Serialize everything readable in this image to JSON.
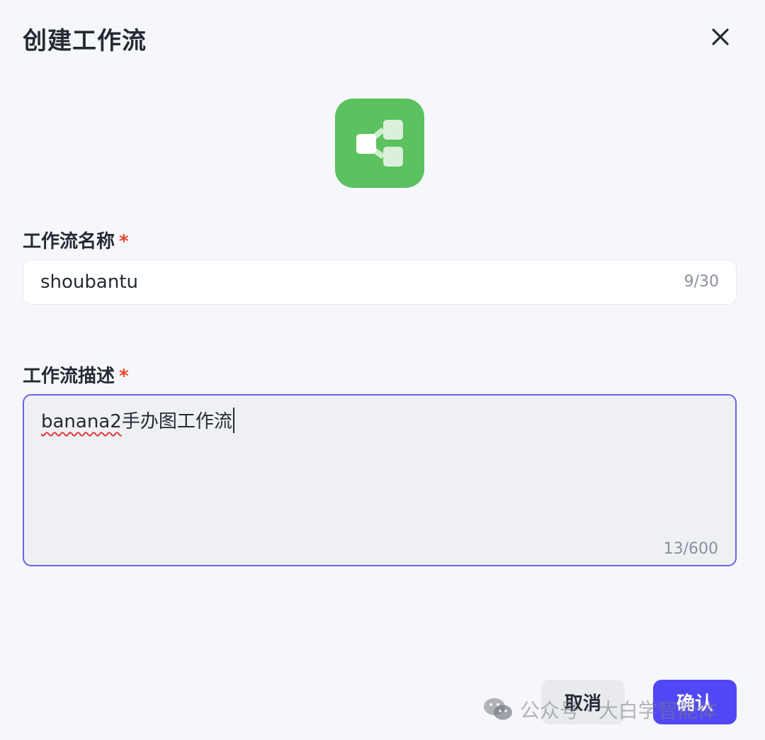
{
  "dialog": {
    "title": "创建工作流",
    "close_icon": "close-icon",
    "workflow_icon": "workflow-share-icon",
    "icon_color": "#5cc15f"
  },
  "name_field": {
    "label": "工作流名称",
    "required_mark": "*",
    "value": "shoubantu",
    "counter": "9/30"
  },
  "description_field": {
    "label": "工作流描述",
    "required_mark": "*",
    "value_misspelled": "banana2",
    "value_rest": "手办图工作流",
    "counter": "13/600"
  },
  "actions": {
    "cancel_label": "取消",
    "confirm_label": "确认",
    "confirm_color": "#5247f5"
  },
  "watermark": {
    "icon": "wechat-icon",
    "text": "公众号 · 大白学智能体"
  }
}
